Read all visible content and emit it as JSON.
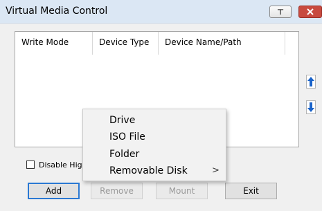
{
  "window": {
    "title": "Virtual Media Control",
    "pin_glyph": "⊤",
    "close_glyph": "✕"
  },
  "table": {
    "columns": [
      "Write Mode",
      "Device Type",
      "Device Name/Path"
    ],
    "rows": []
  },
  "side_buttons": {
    "up_icon": "arrow-up-icon",
    "down_icon": "arrow-down-icon",
    "arrow_color": "#1a63c9"
  },
  "options": {
    "disable_label": "Disable Higl",
    "disable_checked": false
  },
  "buttons": {
    "add": "Add",
    "remove": "Remove",
    "mount": "Mount",
    "exit": "Exit"
  },
  "context_menu": {
    "items": [
      "Drive",
      "ISO File",
      "Folder",
      "Removable Disk"
    ],
    "submenu_arrow": ">"
  }
}
